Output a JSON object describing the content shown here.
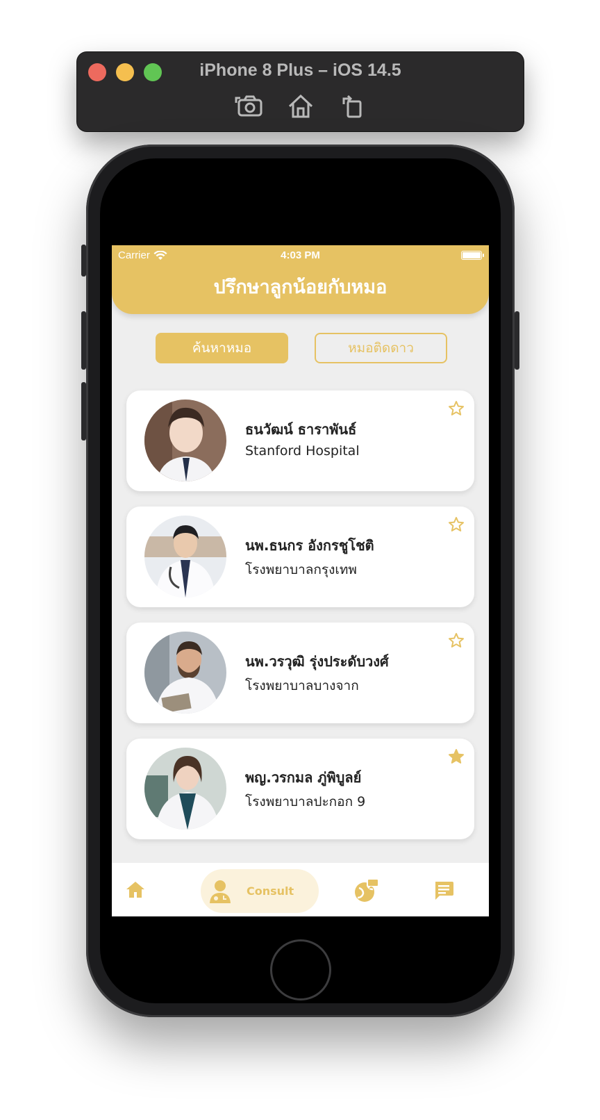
{
  "simulator": {
    "title": "iPhone 8 Plus – iOS 14.5",
    "tools": [
      "screenshot-icon",
      "home-icon",
      "rotate-icon"
    ]
  },
  "status_bar": {
    "carrier": "Carrier",
    "time": "4:03 PM"
  },
  "header": {
    "title": "ปรึกษาลูกน้อยกับหมอ"
  },
  "segments": {
    "search": "ค้นหาหมอ",
    "starred": "หมอติดดาว"
  },
  "doctors": [
    {
      "name": "ธนวัฒน์ ธาราพันธ์",
      "hospital": "Stanford Hospital",
      "starred": false
    },
    {
      "name": "นพ.ธนกร  อังกรชูโชติ",
      "hospital": "โรงพยาบาลกรุงเทพ",
      "starred": false
    },
    {
      "name": "นพ.วรวุฒิ รุ่งประดับวงศ์",
      "hospital": "โรงพยาบาลบางจาก",
      "starred": false
    },
    {
      "name": "พญ.วรกมล ภู่พิบูลย์",
      "hospital": "โรงพยาบาลปะกอก 9",
      "starred": true
    }
  ],
  "tabbar": {
    "consult_label": "Consult",
    "icons": [
      "home-icon",
      "doctor-icon",
      "globe-chat-icon",
      "message-icon"
    ]
  },
  "colors": {
    "accent": "#e6c263",
    "accent_light": "#fbf2dc",
    "background": "#eeeeee"
  }
}
